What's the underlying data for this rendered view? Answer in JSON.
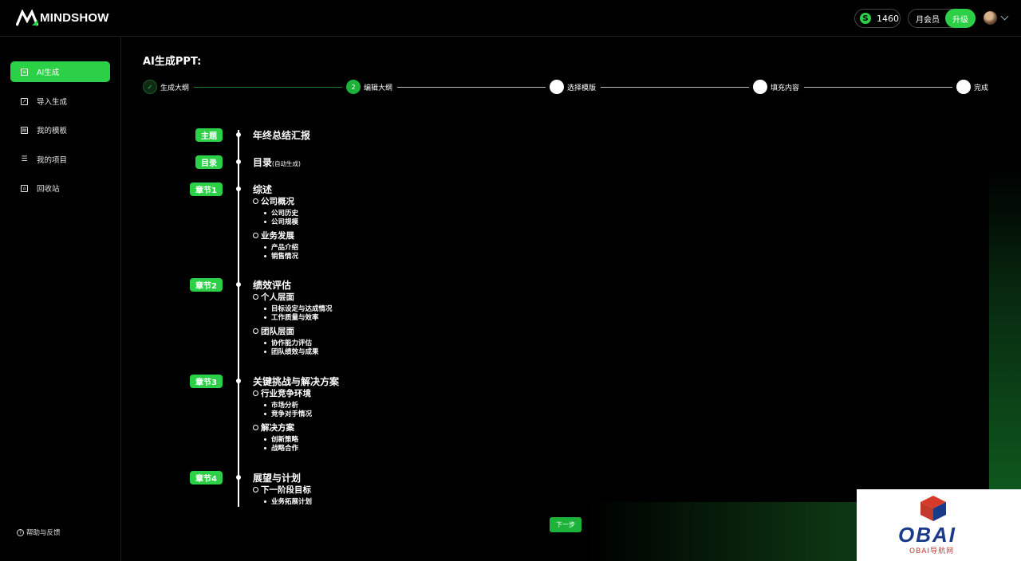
{
  "app": {
    "logo_text": "MINDSHOW"
  },
  "header": {
    "credits": "1460",
    "coin_symbol": "S",
    "membership": "月会员",
    "upgrade": "升级"
  },
  "sidebar": {
    "items": [
      {
        "label": "AI生成",
        "icon": "doc-icon",
        "active": true
      },
      {
        "label": "导入生成",
        "icon": "import-icon"
      },
      {
        "label": "我的模板",
        "icon": "template-icon"
      },
      {
        "label": "我的项目",
        "icon": "list-icon"
      },
      {
        "label": "回收站",
        "icon": "trash-icon"
      }
    ],
    "help": "帮助与反馈"
  },
  "main": {
    "title": "AI生成PPT:",
    "steps": [
      {
        "label": "生成大纲",
        "marker": "✓",
        "state": "done"
      },
      {
        "label": "编辑大纲",
        "marker": "2",
        "state": "current"
      },
      {
        "label": "选择模版",
        "marker": "",
        "state": "todo"
      },
      {
        "label": "填充内容",
        "marker": "",
        "state": "todo"
      },
      {
        "label": "完成",
        "marker": "",
        "state": "todo"
      }
    ],
    "outline": {
      "topic_tag": "主题",
      "topic": "年终总结汇报",
      "toc_tag": "目录",
      "toc": "目录",
      "toc_note": "(自动生成)",
      "chapters": [
        {
          "tag": "章节1",
          "title": "综述",
          "sections": [
            {
              "title": "公司概况",
              "items": [
                "公司历史",
                "公司规模"
              ]
            },
            {
              "title": "业务发展",
              "items": [
                "产品介绍",
                "销售情况"
              ]
            }
          ]
        },
        {
          "tag": "章节2",
          "title": "绩效评估",
          "sections": [
            {
              "title": "个人层面",
              "items": [
                "目标设定与达成情况",
                "工作质量与效率"
              ]
            },
            {
              "title": "团队层面",
              "items": [
                "协作能力评估",
                "团队绩效与成果"
              ]
            }
          ]
        },
        {
          "tag": "章节3",
          "title": "关键挑战与解决方案",
          "sections": [
            {
              "title": "行业竞争环境",
              "items": [
                "市场分析",
                "竞争对手情况"
              ]
            },
            {
              "title": "解决方案",
              "items": [
                "创新策略",
                "战略合作"
              ]
            }
          ]
        },
        {
          "tag": "章节4",
          "title": "展望与计划",
          "sections": [
            {
              "title": "下一阶段目标",
              "items": [
                "业务拓展计划"
              ]
            }
          ]
        }
      ]
    },
    "next_button": "下一步"
  },
  "watermark": {
    "logo_text": "OBAI",
    "sub_text": "OBAI导航网"
  },
  "colors": {
    "accent": "#2bd046",
    "background": "#000000",
    "watermark_blue": "#1a3a8a",
    "watermark_red": "#c0392b"
  }
}
